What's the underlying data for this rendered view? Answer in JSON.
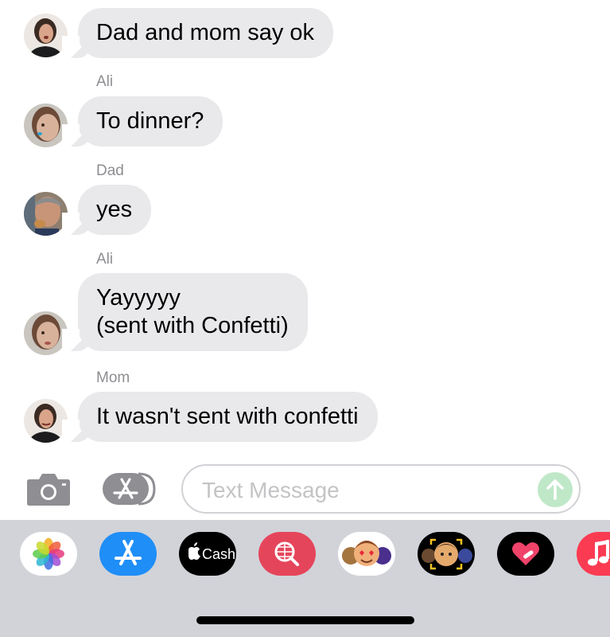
{
  "messages": [
    {
      "sender": "",
      "text": "Dad and mom say ok"
    },
    {
      "sender": "Ali",
      "text": "To dinner?"
    },
    {
      "sender": "Dad",
      "text": "yes"
    },
    {
      "sender": "Ali",
      "text": "Yayyyyy\n(sent with Confetti)"
    },
    {
      "sender": "Mom",
      "text": "It wasn't sent with confetti"
    }
  ],
  "composer": {
    "placeholder": "Text Message",
    "value": ""
  },
  "app_tray": {
    "items": [
      "photos-app-icon",
      "app-store-icon",
      "apple-cash-icon",
      "web-search-icon",
      "memoji-stickers-icon",
      "animoji-icon",
      "digital-touch-icon",
      "music-icon"
    ],
    "cash_label": "Cash"
  },
  "colors": {
    "bubble": "#e9e9eb",
    "tray": "#d1d3d9",
    "send": "#bfe8c8",
    "app_store_blue": "#1f8ef7",
    "search_red": "#e5455b",
    "music_red": "#fa3b52"
  }
}
